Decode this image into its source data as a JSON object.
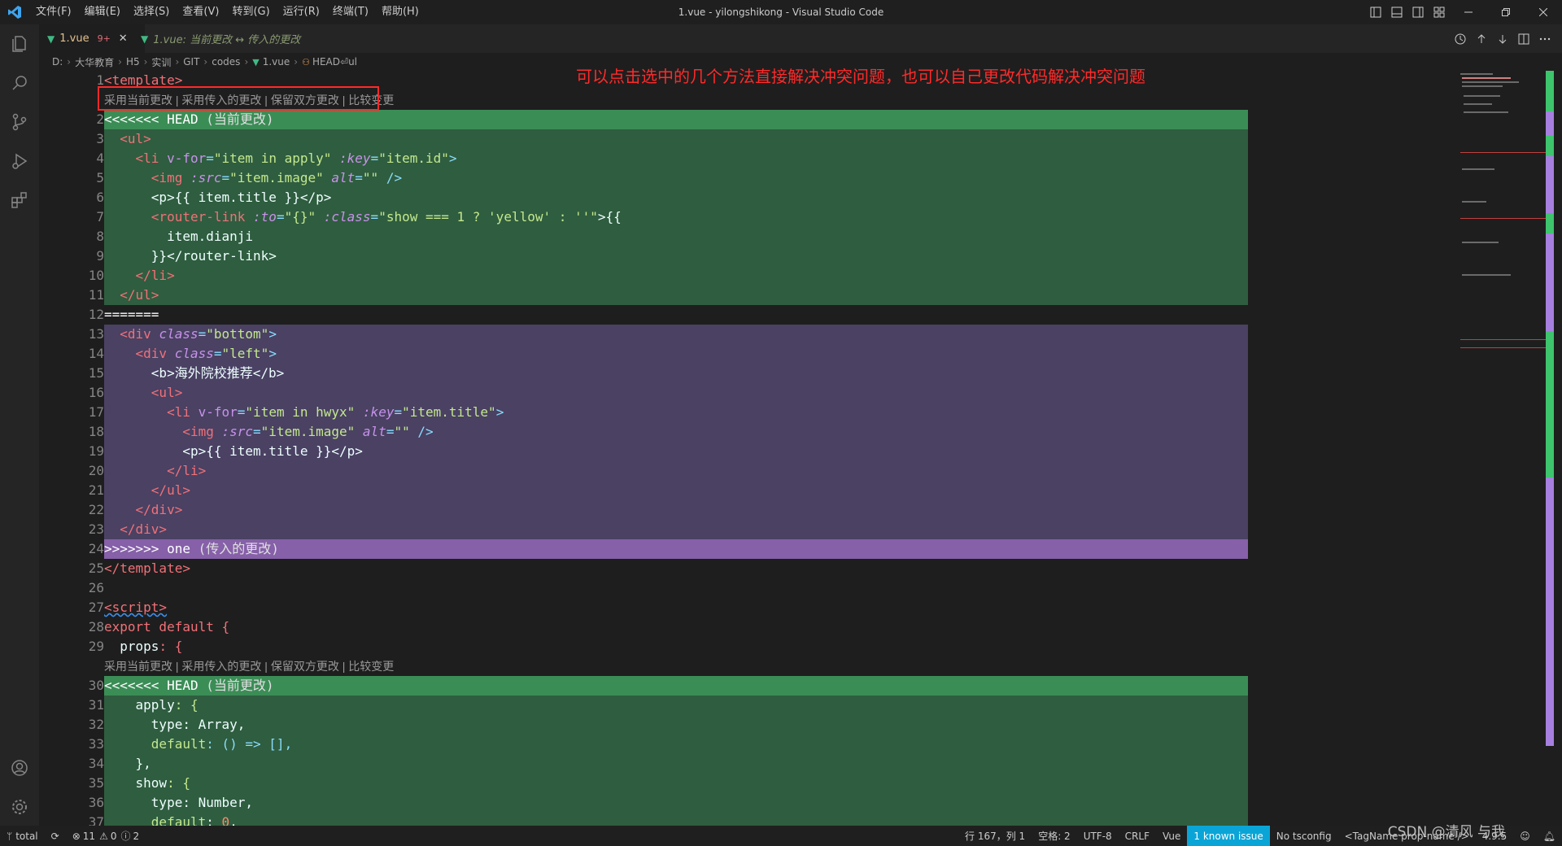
{
  "window": {
    "title": "1.vue - yilongshikong - Visual Studio Code",
    "menu": [
      "文件(F)",
      "编辑(E)",
      "选择(S)",
      "查看(V)",
      "转到(G)",
      "运行(R)",
      "终端(T)",
      "帮助(H)"
    ]
  },
  "tabs": [
    {
      "label": "1.vue",
      "badge": "9+"
    },
    {
      "label": "1.vue: 当前更改 ↔ 传入的更改"
    }
  ],
  "breadcrumb": [
    "D:",
    "大华教育",
    "H5",
    "实训",
    "GIT",
    "codes",
    "1.vue",
    "HEAD⏎ul"
  ],
  "annotation": "可以点击选中的几个方法直接解决冲突问题，也可以自己更改代码解决冲突问题",
  "codelens": [
    "采用当前更改",
    "采用传入的更改",
    "保留双方更改",
    "比较变更"
  ],
  "codelens_text": "采用当前更改 | 采用传入的更改 | 保留双方更改 | 比较变更",
  "line_numbers": [
    "1",
    "",
    "2",
    "3",
    "4",
    "5",
    "6",
    "7",
    "8",
    "9",
    "10",
    "11",
    "12",
    "13",
    "14",
    "15",
    "16",
    "17",
    "18",
    "19",
    "20",
    "21",
    "22",
    "23",
    "24",
    "25",
    "26",
    "27",
    "28",
    "29",
    "",
    "30",
    "31",
    "32",
    "33",
    "34",
    "35",
    "36",
    "37"
  ],
  "code": {
    "l1": "<template>",
    "l2_marker": "<<<<<<< HEAD",
    "l2_label": "(当前更改)",
    "l3": "<ul>",
    "l4a": "<li",
    "l4b": "v-for",
    "l4c": "\"item in apply\"",
    "l4d": ":key",
    "l4e": "\"item.id\"",
    "l5a": "<img",
    "l5b": ":src",
    "l5c": "\"item.image\"",
    "l5d": "alt",
    "l5e": "\"\"",
    "l6": "<p>{{ item.title }}</p>",
    "l7a": "<router-link",
    "l7b": ":to",
    "l7c": "\"{}\"",
    "l7d": ":class",
    "l7e": "\"show === 1 ? 'yellow' : ''\"",
    "l7f": ">{{",
    "l8": "item.dianji",
    "l9": "}}</router-link>",
    "l10": "</li>",
    "l11": "</ul>",
    "l12": "=======",
    "l13a": "<div",
    "l13b": "class",
    "l13c": "\"bottom\"",
    "l14a": "<div",
    "l14b": "class",
    "l14c": "\"left\"",
    "l15": "<b>海外院校推荐</b>",
    "l16": "<ul>",
    "l17a": "<li",
    "l17b": "v-for",
    "l17c": "\"item in hwyx\"",
    "l17d": ":key",
    "l17e": "\"item.title\"",
    "l18a": "<img",
    "l18b": ":src",
    "l18c": "\"item.image\"",
    "l18d": "alt",
    "l18e": "\"\"",
    "l19": "<p>{{ item.title }}</p>",
    "l20": "</li>",
    "l21": "</ul>",
    "l22": "</div>",
    "l23": "</div>",
    "l24_marker": ">>>>>>> one",
    "l24_label": "(传入的更改)",
    "l25": "</template>",
    "l27": "<script>",
    "l28a": "export default",
    "l28b": "{",
    "l29a": "props",
    "l29b": ": {",
    "l30_marker": "<<<<<<< HEAD",
    "l30_label": "(当前更改)",
    "l31a": "apply",
    "l31b": ": {",
    "l32a": "type",
    "l32b": ": Array,",
    "l33a": "default",
    "l33b": ": () => [],",
    "l34": "},",
    "l35a": "show",
    "l35b": ": {",
    "l36a": "type",
    "l36b": ": Number,",
    "l37a": "default",
    "l37b": ": ",
    "l37c": "0",
    "l37d": ","
  },
  "status": {
    "branch": "total",
    "errors": "11",
    "warnings": "0",
    "infos": "2",
    "position": "行 167，列 1",
    "spaces": "空格: 2",
    "encoding": "UTF-8",
    "eol": "CRLF",
    "language": "Vue",
    "known_issue": "1 known issue",
    "tsconfig": "No tsconfig",
    "tag_name": "<TagName prop-name />",
    "version": "4.9.5"
  },
  "watermark": "CSDN @清风 与我"
}
